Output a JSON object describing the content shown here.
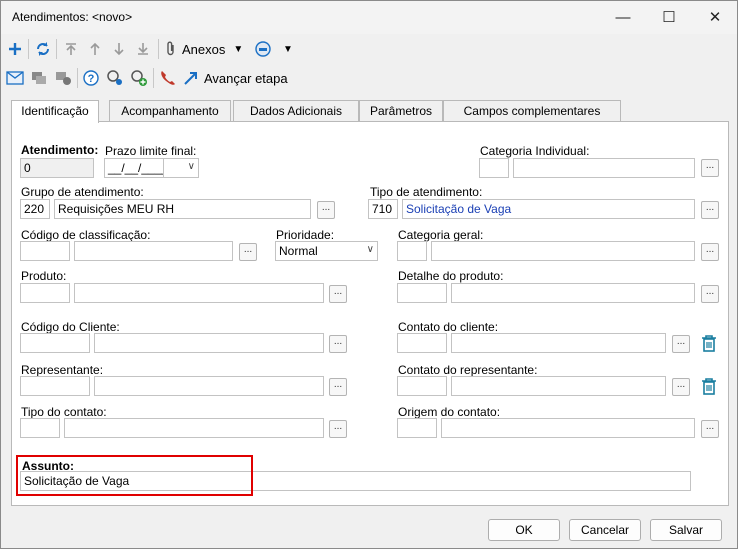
{
  "window": {
    "title": "Atendimentos: <novo>"
  },
  "toolbar1": {
    "attachments_label": "Anexos"
  },
  "toolbar2": {
    "advance_label": "Avançar etapa"
  },
  "tabs": [
    {
      "label": "Identificação"
    },
    {
      "label": "Acompanhamento"
    },
    {
      "label": "Dados Adicionais"
    },
    {
      "label": "Parâmetros"
    },
    {
      "label": "Campos complementares"
    }
  ],
  "form": {
    "atendimento": {
      "label": "Atendimento:",
      "value": "0"
    },
    "prazo": {
      "label": "Prazo limite final:",
      "value": "__/__/____"
    },
    "categoria_individual": {
      "label": "Categoria Individual:",
      "code": "",
      "value": ""
    },
    "grupo": {
      "label": "Grupo de atendimento:",
      "code": "220",
      "value": "Requisições MEU RH"
    },
    "tipo": {
      "label": "Tipo de atendimento:",
      "code": "710",
      "value": "Solicitação de Vaga"
    },
    "classificacao": {
      "label": "Código de classificação:",
      "code": "",
      "value": ""
    },
    "prioridade": {
      "label": "Prioridade:",
      "value": "Normal"
    },
    "categoria_geral": {
      "label": "Categoria geral:",
      "code": "",
      "value": ""
    },
    "produto": {
      "label": "Produto:",
      "code": "",
      "value": ""
    },
    "detalhe_produto": {
      "label": "Detalhe do produto:",
      "code": "",
      "value": ""
    },
    "cliente": {
      "label": "Código do Cliente:",
      "code": "",
      "value": ""
    },
    "contato_cliente": {
      "label": "Contato do cliente:",
      "code": "",
      "value": ""
    },
    "representante": {
      "label": "Representante:",
      "code": "",
      "value": ""
    },
    "contato_representante": {
      "label": "Contato do representante:",
      "code": "",
      "value": ""
    },
    "tipo_contato": {
      "label": "Tipo do contato:",
      "code": "",
      "value": ""
    },
    "origem_contato": {
      "label": "Origem do contato:",
      "code": "",
      "value": ""
    },
    "assunto": {
      "label": "Assunto:",
      "value": "Solicitação de Vaga"
    },
    "browse_label": "..."
  },
  "buttons": {
    "ok": "OK",
    "cancel": "Cancelar",
    "save": "Salvar"
  },
  "colors": {
    "accent_blue": "#1a6fc4",
    "highlight_red": "#e00000",
    "trash_teal": "#1a7fa0"
  }
}
